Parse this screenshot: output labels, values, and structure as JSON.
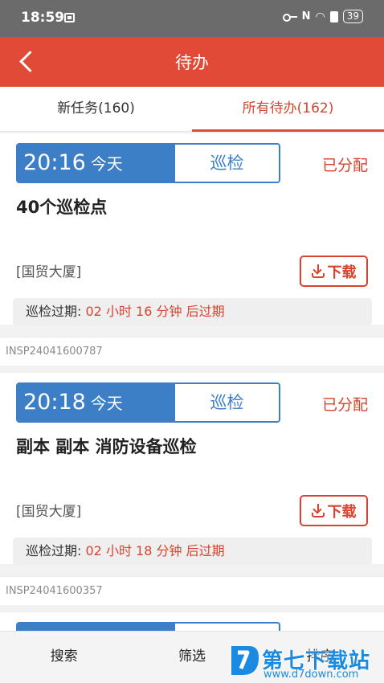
{
  "status_bar": {
    "time": "18:59",
    "signal_text": "N",
    "battery": "39"
  },
  "header": {
    "title": "待办"
  },
  "tabs": [
    {
      "label": "新任务(160)",
      "active": false
    },
    {
      "label": "所有待办(162)",
      "active": true
    }
  ],
  "tasks": [
    {
      "time": "20:16",
      "day": "今天",
      "type": "巡检",
      "status": "已分配",
      "title": "40个巡检点",
      "location": "[国贸大厦]",
      "download_label": "下载",
      "expire_label": "巡检过期:",
      "expire_value": "02 小时 16 分钟 后过期",
      "code": "INSP24041600787"
    },
    {
      "time": "20:18",
      "day": "今天",
      "type": "巡检",
      "status": "已分配",
      "title": "副本 副本 消防设备巡检",
      "location": "[国贸大厦]",
      "download_label": "下载",
      "expire_label": "巡检过期:",
      "expire_value": "02 小时 18 分钟 后过期",
      "code": "INSP24041600357"
    }
  ],
  "bottom_bar": {
    "search": "搜索",
    "filter": "筛选",
    "sort": "排序"
  },
  "watermark": {
    "name": "第七下载站",
    "url": "www.d7down.com"
  },
  "colors": {
    "primary_red": "#e14a37",
    "tag_blue": "#3c7fc7",
    "watermark_blue": "#1a8be0"
  }
}
